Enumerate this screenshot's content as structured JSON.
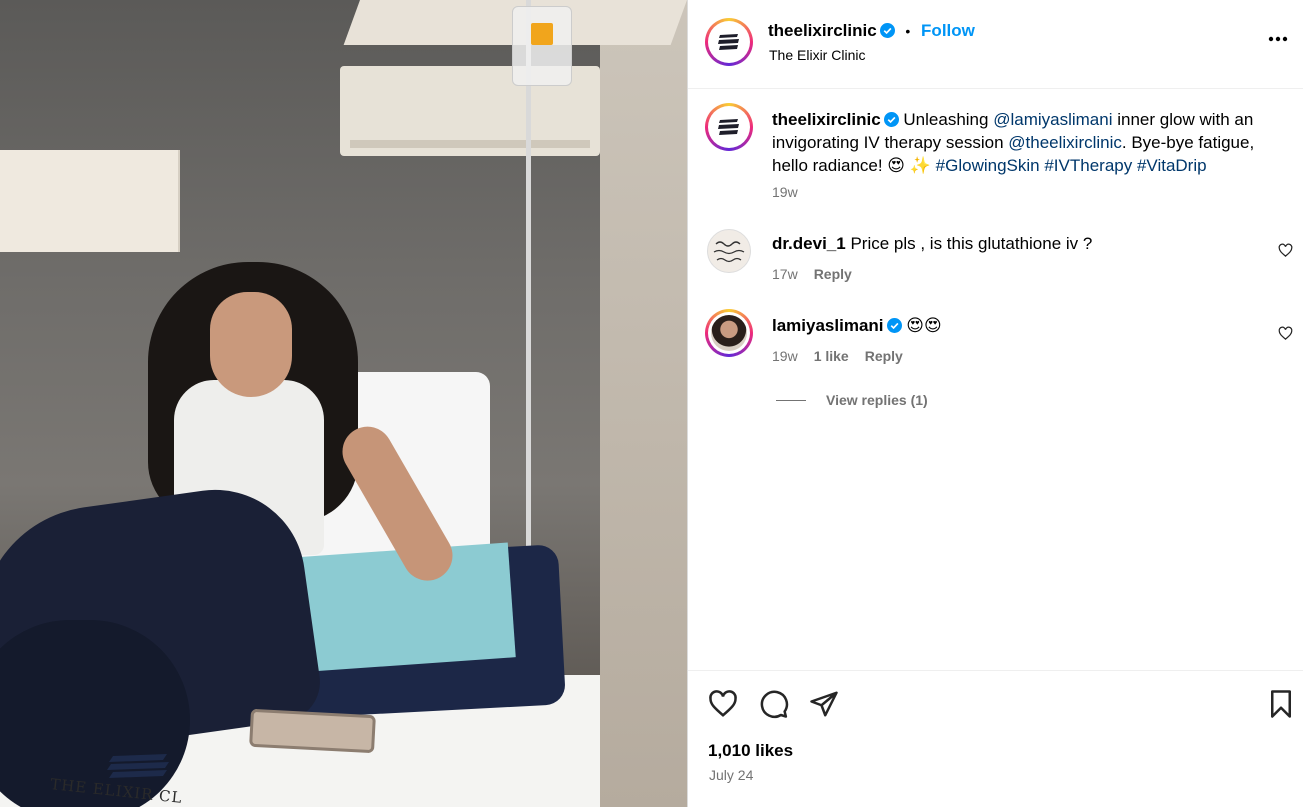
{
  "post": {
    "account": {
      "username": "theelixirclinic",
      "display_name": "The Elixir Clinic",
      "verified": true,
      "follow_label": "Follow",
      "separator": "•"
    },
    "photo": {
      "watermark_text": "THE ELIXIR CL"
    },
    "caption": {
      "username": "theelixirclinic",
      "text_1": "Unleashing",
      "mention_1": "@lamiyaslimani",
      "text_2": "inner glow with an invigorating IV therapy session",
      "mention_2": "@theelixirclinic",
      "text_3": ". Bye-bye fatigue, hello radiance! 😍 ✨",
      "hashtags": [
        "#GlowingSkin",
        "#IVTherapy",
        "#VitaDrip"
      ],
      "time": "19w"
    },
    "comments": [
      {
        "username": "dr.devi_1",
        "text": "Price pls , is this glutathione iv ?",
        "time": "17w",
        "reply_label": "Reply"
      },
      {
        "username": "lamiyaslimani",
        "verified": true,
        "text": "😍😍",
        "time": "19w",
        "likes": "1 like",
        "reply_label": "Reply",
        "view_replies": "View replies (1)"
      }
    ],
    "likes_count": "1,010 likes",
    "date": "July 24"
  },
  "icons": {
    "more": "more-options-icon",
    "heart": "heart-icon",
    "comment": "comment-icon",
    "share": "share-icon",
    "save": "bookmark-icon",
    "verified": "verified-badge-icon"
  },
  "colors": {
    "follow": "#0095f6",
    "link": "#00376b",
    "muted": "#737373",
    "verified": "#0095f6"
  }
}
